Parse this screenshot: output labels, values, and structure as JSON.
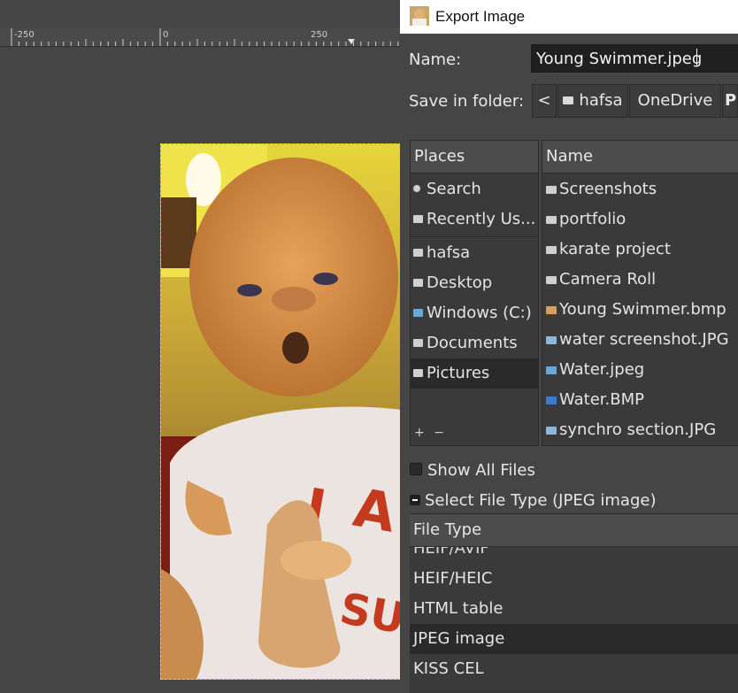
{
  "ruler": {
    "labels": [
      "-250",
      "0",
      "250"
    ]
  },
  "dialog": {
    "title": "Export Image",
    "name_label": "Name:",
    "filename": "Young Swimmer.jpeg",
    "save_in_label": "Save in folder:",
    "breadcrumb": {
      "back_glyph": "<",
      "items": [
        "hafsa",
        "OneDrive",
        "Pi"
      ]
    },
    "places": {
      "header": "Places",
      "items": [
        "Search",
        "Recently Us...",
        "hafsa",
        "Desktop",
        "Windows (C:)",
        "Documents",
        "Pictures"
      ],
      "selected": "Pictures",
      "add_glyph": "+",
      "remove_glyph": "−"
    },
    "files": {
      "header": "Name",
      "items": [
        {
          "name": "Screenshots",
          "icon": "folder-icon"
        },
        {
          "name": "portfolio",
          "icon": "folder-icon"
        },
        {
          "name": "karate project",
          "icon": "folder-icon"
        },
        {
          "name": "Camera Roll",
          "icon": "folder-icon"
        },
        {
          "name": "Young Swimmer.bmp",
          "icon": "image-file-icon"
        },
        {
          "name": "water screenshot.JPG",
          "icon": "image-file-icon"
        },
        {
          "name": "Water.jpeg",
          "icon": "image-file-icon"
        },
        {
          "name": "Water.BMP",
          "icon": "image-file-icon"
        },
        {
          "name": "synchro section.JPG",
          "icon": "image-file-icon"
        }
      ]
    },
    "show_all_files": "Show All Files",
    "select_file_type": "Select File Type (JPEG image)",
    "file_type": {
      "header": "File Type",
      "rows": [
        "HEIF/AVIF",
        "HEIF/HEIC",
        "HTML table",
        "JPEG image",
        "KISS CEL"
      ],
      "selected": "JPEG image"
    }
  },
  "colors": {
    "canvas_bg": "#454545",
    "selection_marching_ants": "#e8d400",
    "titlebar_bg": "#ffffff"
  }
}
